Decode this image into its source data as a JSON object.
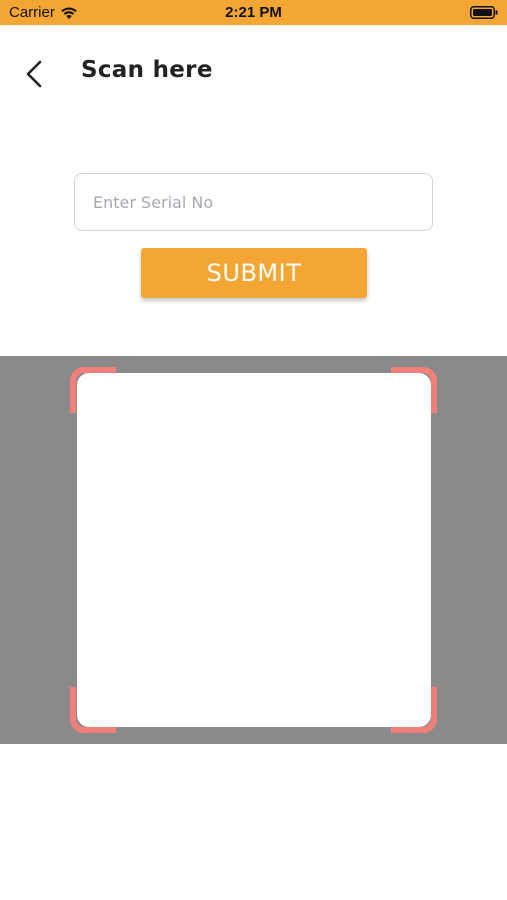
{
  "status_bar": {
    "carrier": "Carrier",
    "time": "2:21 PM",
    "icons": [
      "wifi-icon",
      "battery-icon"
    ]
  },
  "header": {
    "title": "Scan here",
    "back_icon": "chevron-left-icon"
  },
  "serial": {
    "value": "",
    "placeholder": "Enter Serial No"
  },
  "submit": {
    "label": "SUBMIT"
  },
  "colors": {
    "accent": "#f4a634",
    "scanner_frame": "#f47f7a",
    "scanner_background": "#8a8a8a"
  }
}
